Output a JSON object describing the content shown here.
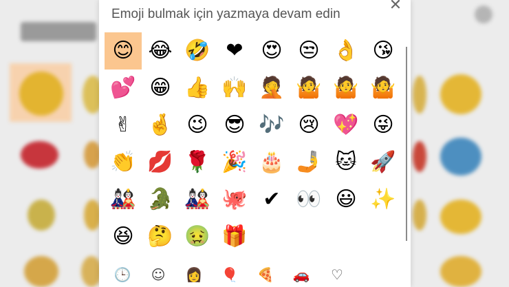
{
  "panel": {
    "search_prompt": "Emoji bulmak için yazmaya devam edin",
    "close_glyph": "✕"
  },
  "emojis": [
    "😊",
    "😂",
    "🤣",
    "❤",
    "😍",
    "😒",
    "👌",
    "😘",
    "💕",
    "😁",
    "👍",
    "🙌",
    "🤦",
    "🤷",
    "🤷",
    "🤷",
    "✌",
    "🤞",
    "😉",
    "😎",
    "🎶",
    "😢",
    "💖",
    "😜",
    "👏",
    "💋",
    "🌹",
    "🎉",
    "🎂",
    "🤳",
    "🐱",
    "🚀",
    "🎎",
    "🐊",
    "🎎",
    "🐙",
    "✔",
    "👀",
    "😃",
    "✨",
    "😆",
    "🤔",
    "🤢",
    "🎁"
  ],
  "tabs": [
    {
      "name": "recent-icon",
      "glyph": "🕒"
    },
    {
      "name": "smiley-icon",
      "glyph": "☺"
    },
    {
      "name": "person-icon",
      "glyph": "👩"
    },
    {
      "name": "balloon-icon",
      "glyph": "🎈"
    },
    {
      "name": "pizza-icon",
      "glyph": "🍕"
    },
    {
      "name": "car-icon",
      "glyph": "🚗"
    },
    {
      "name": "heart-icon",
      "glyph": "♡"
    }
  ],
  "colors": {
    "selected_cell": "#fbc68f",
    "active_tab": "#e98a1a"
  }
}
